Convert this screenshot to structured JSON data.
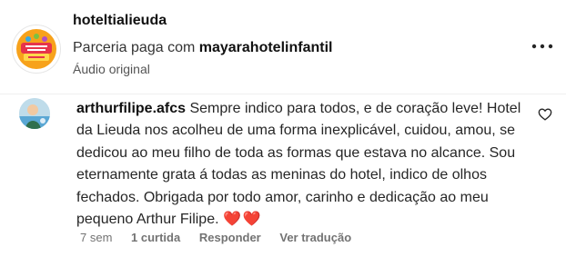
{
  "post": {
    "username": "hoteltialieuda",
    "partnership_prefix": "Parceria paga com",
    "partner": "mayarahotelinfantil",
    "audio": "Áudio original",
    "avatar_text_top": "Tia Lieuda",
    "avatar_text_bottom": "hotel infantil"
  },
  "comment": {
    "author": "arthurfilipe.afcs",
    "text": "Sempre indico para todos, e de coração leve! Hotel da Lieuda nos acolheu de uma forma inexplicável, cuidou, amou, se dedicou ao meu filho de toda as formas que estava no alcance. Sou eternamente grata á todas as meninas do hotel, indico de olhos fechados. Obrigada por todo amor, carinho e dedicação ao meu pequeno Arthur Filipe.",
    "hearts": "❤️❤️",
    "time": "7 sem",
    "likes": "1 curtida",
    "reply": "Responder",
    "translate": "Ver tradução"
  },
  "colors": {
    "heart": "#e0182d",
    "muted": "#737373",
    "avatar_accent": "#f7a21b"
  }
}
